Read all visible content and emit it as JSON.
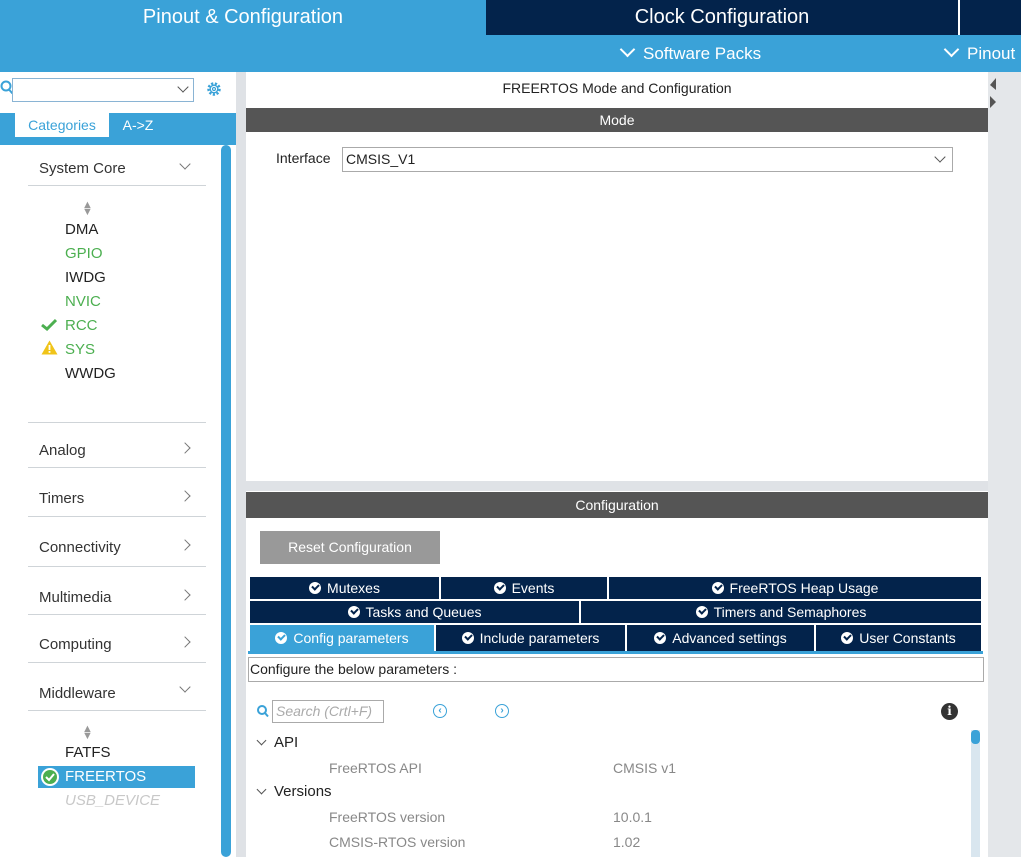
{
  "top_tabs": {
    "pinout": "Pinout & Configuration",
    "clock": "Clock Configuration"
  },
  "sub_menu": {
    "software_packs": "Software Packs",
    "pinout": "Pinout"
  },
  "left_panel": {
    "tabs": {
      "categories": "Categories",
      "az": "A->Z"
    },
    "categories": {
      "system_core": "System Core",
      "analog": "Analog",
      "timers": "Timers",
      "connectivity": "Connectivity",
      "multimedia": "Multimedia",
      "computing": "Computing",
      "middleware": "Middleware"
    },
    "system_core_items": [
      {
        "label": "DMA",
        "color": "#333333"
      },
      {
        "label": "GPIO",
        "color": "#4caf50"
      },
      {
        "label": "IWDG",
        "color": "#333333"
      },
      {
        "label": "NVIC",
        "color": "#4caf50"
      },
      {
        "label": "RCC",
        "color": "#4caf50",
        "icon": "check-icon"
      },
      {
        "label": "SYS",
        "color": "#4caf50",
        "icon": "warning-icon"
      },
      {
        "label": "WWDG",
        "color": "#333333"
      }
    ],
    "middleware_items": [
      {
        "label": "FATFS",
        "color": "#333333"
      },
      {
        "label": "FREERTOS",
        "color": "#ffffff",
        "selected": true,
        "icon": "check-circle-icon"
      },
      {
        "label": "USB_DEVICE",
        "color": "#c8c8c8",
        "disabled": true
      }
    ]
  },
  "main": {
    "title": "FREERTOS Mode and Configuration",
    "mode_header": "Mode",
    "interface_label": "Interface",
    "interface_value": "CMSIS_V1",
    "config_header": "Configuration",
    "reset_button": "Reset Configuration",
    "param_tabs_row1": [
      "Mutexes",
      "Events",
      "FreeRTOS Heap Usage"
    ],
    "param_tabs_row2": [
      "Tasks and Queues",
      "Timers and Semaphores"
    ],
    "param_tabs_row3": [
      "Config parameters",
      "Include parameters",
      "Advanced settings",
      "User Constants"
    ],
    "configure_text": "Configure the below parameters :",
    "search_placeholder": "Search (Crtl+F)",
    "groups": [
      {
        "name": "API",
        "params": [
          {
            "name": "FreeRTOS API",
            "value": "CMSIS v1"
          }
        ]
      },
      {
        "name": "Versions",
        "params": [
          {
            "name": "FreeRTOS version",
            "value": "10.0.1"
          },
          {
            "name": "CMSIS-RTOS version",
            "value": "1.02"
          }
        ]
      }
    ]
  },
  "colors": {
    "accent": "#3aa2d8",
    "navy": "#03234b",
    "ok": "#4caf50",
    "warn": "#f0c419"
  }
}
